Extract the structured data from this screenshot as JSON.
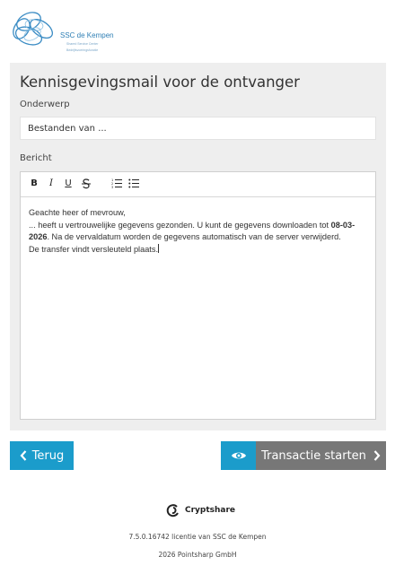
{
  "branding": {
    "org_name": "SSC de Kempen",
    "tagline_1": "Shared Service Center",
    "tagline_2": "Bedrijfsvoeringsfunctie"
  },
  "panel": {
    "title": "Kennisgevingsmail voor de ontvanger",
    "subject_label": "Onderwerp",
    "subject_value": "Bestanden van ...",
    "message_label": "Bericht",
    "message": {
      "greeting": "Geachte heer of mevrouw,",
      "line2_prefix": "... heeft u vertrouwelijke gegevens gezonden. U kunt de gegevens downloaden tot ",
      "date": "08-03-2026",
      "line2_suffix": ". Na de vervaldatum worden de gegevens automatisch van de server verwijderd.",
      "line3": "De transfer vindt versleuteld plaats."
    }
  },
  "toolbar": {
    "bold": "B",
    "italic": "I",
    "underline": "U",
    "strikethrough": "S",
    "ordered_list_icon": "ordered-list-icon",
    "bullet_list_icon": "bullet-list-icon"
  },
  "actions": {
    "back_label": "Terug",
    "start_label": "Transactie starten",
    "preview_icon": "eye-icon"
  },
  "footer": {
    "product": "Cryptshare",
    "license": "7.5.0.16742 licentie van SSC de Kempen",
    "copyright": "2026 Pointsharp GmbH"
  },
  "colors": {
    "accent": "#1b9ccb",
    "start_button": "#777777",
    "panel_bg": "#eeeeee"
  }
}
